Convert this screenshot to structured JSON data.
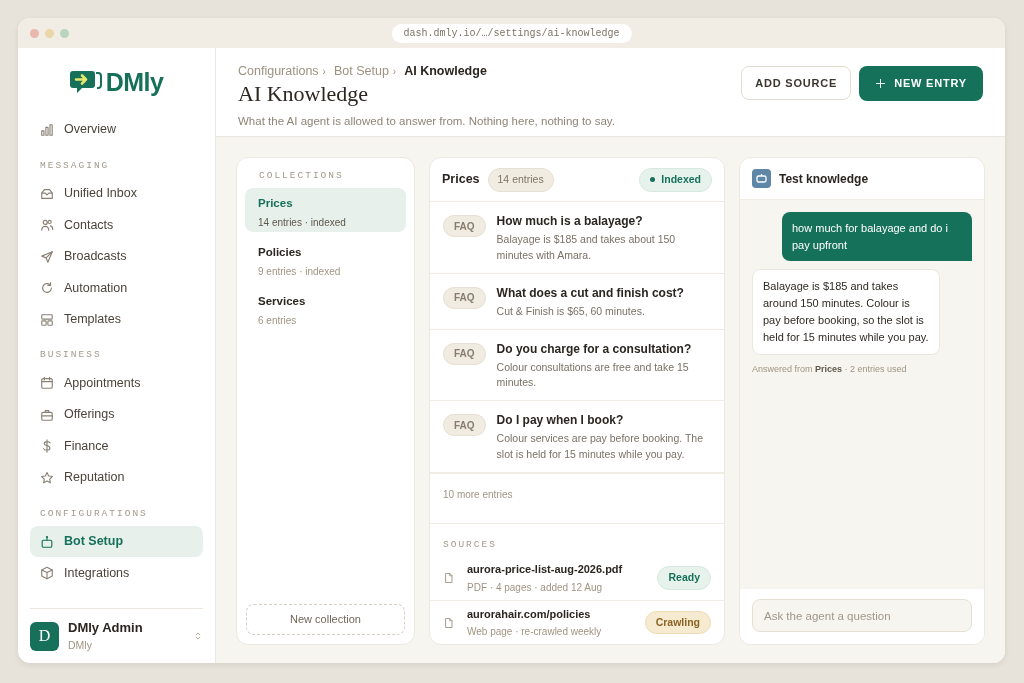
{
  "browser": {
    "url": "dash.dmly.io/…/settings/ai-knowledge"
  },
  "sidebar": {
    "logo": "DMly",
    "groups": [
      {
        "items": [
          {
            "label": "Overview",
            "selected": false
          }
        ]
      },
      {
        "heading": "MESSAGING",
        "items": [
          {
            "label": "Unified Inbox",
            "selected": false
          },
          {
            "label": "Contacts",
            "selected": false
          },
          {
            "label": "Broadcasts",
            "selected": false
          },
          {
            "label": "Automation",
            "selected": false
          },
          {
            "label": "Templates",
            "selected": false
          }
        ]
      },
      {
        "heading": "BUSINESS",
        "items": [
          {
            "label": "Appointments",
            "selected": false
          },
          {
            "label": "Offerings",
            "selected": false
          },
          {
            "label": "Finance",
            "selected": false
          },
          {
            "label": "Reputation",
            "selected": false
          }
        ]
      },
      {
        "heading": "CONFIGURATIONS",
        "items": [
          {
            "label": "Bot Setup",
            "selected": true
          },
          {
            "label": "Integrations",
            "selected": false
          }
        ]
      }
    ],
    "user": {
      "initial": "D",
      "name": "DMly Admin",
      "org": "DMly"
    }
  },
  "header": {
    "breadcrumbs": [
      "Configurations",
      "Bot Setup",
      "AI Knowledge"
    ],
    "separator": "›",
    "title": "AI Knowledge",
    "subtitle": "What the AI agent is allowed to answer from. Nothing here, nothing to say.",
    "buttons": [
      {
        "label": "ADD SOURCE",
        "kind": "outline"
      },
      {
        "label": "NEW ENTRY",
        "kind": "primary"
      }
    ]
  },
  "collections": {
    "heading": "COLLECTIONS",
    "items": [
      {
        "name": "Prices",
        "meta": "14 entries · indexed",
        "selected": true
      },
      {
        "name": "Policies",
        "meta": "9 entries · indexed",
        "selected": false
      },
      {
        "name": "Services",
        "meta": "6 entries",
        "selected": false
      }
    ],
    "new_button": "New collection"
  },
  "entries": {
    "title": "Prices",
    "count": "14 entries",
    "status": "Indexed",
    "items": [
      {
        "tag": "FAQ",
        "question": "How much is a balayage?",
        "answer": "Balayage is $185 and takes about 150 minutes with Amara."
      },
      {
        "tag": "FAQ",
        "question": "What does a cut and finish cost?",
        "answer": "Cut & Finish is $65, 60 minutes."
      },
      {
        "tag": "FAQ",
        "question": "Do you charge for a consultation?",
        "answer": "Colour consultations are free and take 15 minutes."
      },
      {
        "tag": "FAQ",
        "question": "Do I pay when I book?",
        "answer": "Colour services are pay before booking. The slot is held for 15 minutes while you pay."
      }
    ],
    "more": "10 more entries",
    "sources_heading": "SOURCES",
    "sources": [
      {
        "name": "aurora-price-list-aug-2026.pdf",
        "meta": "PDF · 4 pages · added 12 Aug",
        "status": "Ready",
        "kind": "ready"
      },
      {
        "name": "aurorahair.com/policies",
        "meta": "Web page · re-crawled weekly",
        "status": "Crawling",
        "kind": "crawling"
      }
    ]
  },
  "test": {
    "title": "Test knowledge",
    "messages": [
      {
        "kind": "outgoing",
        "text": "how much for balayage and do i pay upfront"
      },
      {
        "kind": "incoming",
        "text": "Balayage is $185 and takes around 150 minutes. Colour is pay before booking, so the slot is held for 15 minutes while you pay."
      }
    ],
    "footnote": "Answered from **Prices** · 2 entries used",
    "placeholder": "Ask the agent a question"
  }
}
